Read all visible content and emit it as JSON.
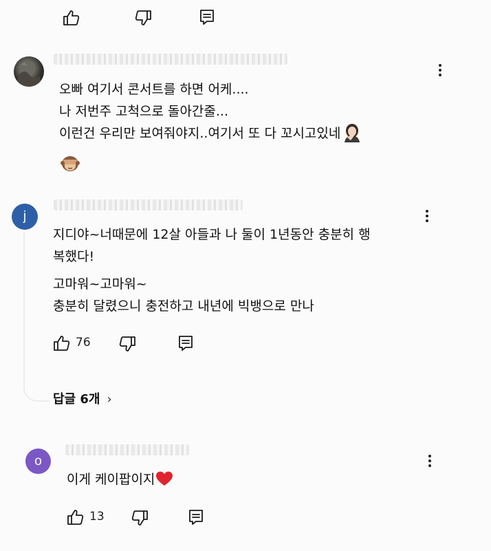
{
  "top_actions": {
    "like_count": ""
  },
  "comments": [
    {
      "author_blurred": true,
      "lines": [
        "오빠 여기서 콘서트를 하면 어케....",
        "나 저번주 고척으로 돌아간줄...",
        "이런건 우리만 보여줘야지..여기서 또 다 꼬시고있네"
      ],
      "emoji_inline": "woman-facepalming",
      "emoji_extra": "see-no-evil-monkey"
    },
    {
      "author_blurred": true,
      "avatar_letter": "j",
      "avatar_color": "#2d5fa8",
      "lines": [
        "지디야~너때문에 12살 아들과 나 둘이 1년동안 충분히 행",
        "복했다!",
        "고마워~고마워~",
        "충분히 달렸으니 충전하고 내년에 빅뱅으로 만나"
      ],
      "like_count": "76",
      "replies_label": "답글 6개",
      "replies_chevron": "›"
    },
    {
      "author_blurred": true,
      "avatar_letter": "o",
      "avatar_color": "#7b58c6",
      "lines": [
        "이게 케이팝이지"
      ],
      "emoji_inline": "red-heart",
      "like_count": "13"
    }
  ]
}
